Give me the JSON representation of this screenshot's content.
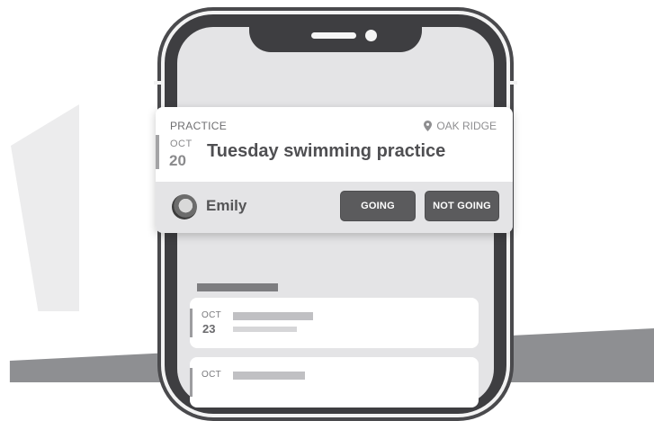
{
  "event": {
    "category": "PRACTICE",
    "location": "OAK RIDGE",
    "month": "OCT",
    "day": "20",
    "title": "Tuesday swimming practice",
    "user": "Emily",
    "buttons": {
      "going": "GOING",
      "not_going": "NOT GOING"
    }
  },
  "background_list": {
    "items": [
      {
        "month": "OCT",
        "day": "23"
      },
      {
        "month": "OCT",
        "day": ""
      }
    ]
  },
  "icons": {
    "location": "map-pin-icon",
    "avatar": "user-avatar"
  },
  "colors": {
    "button": "#5b5b5d",
    "accent": "#a3a3a5",
    "floor": "#8e8f92"
  }
}
